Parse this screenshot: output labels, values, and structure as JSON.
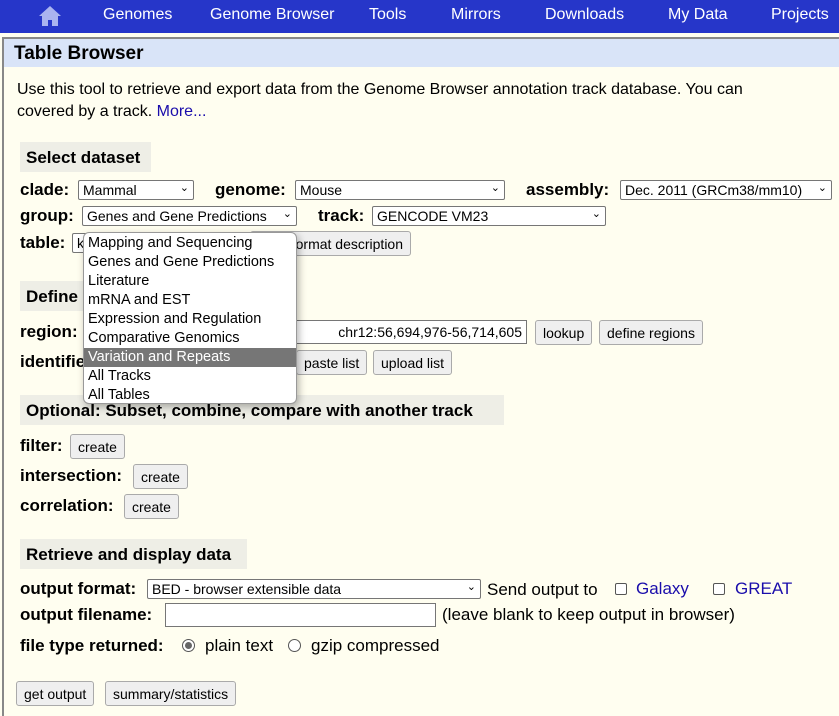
{
  "nav": {
    "home_icon": "home-icon",
    "items": [
      "Genomes",
      "Genome Browser",
      "Tools",
      "Mirrors",
      "Downloads",
      "My Data",
      "Projects"
    ]
  },
  "title": "Table Browser",
  "intro": {
    "line1": "Use this tool to retrieve and export data from the Genome Browser annotation track database. You can",
    "line2": "covered by a track.",
    "more": "More..."
  },
  "dataset": {
    "header": "Select dataset",
    "clade_label": "clade:",
    "clade": "Mammal",
    "genome_label": "genome:",
    "genome": "Mouse",
    "assembly_label": "assembly:",
    "assembly": "Dec. 2011 (GRCm38/mm10)",
    "group_label": "group:",
    "group": "Genes and Gene Predictions",
    "track_label": "track:",
    "track": "GENCODE VM23",
    "table_label": "table:",
    "table": "knownGene",
    "describe_button": "data format description"
  },
  "group_options": [
    "Mapping and Sequencing",
    "Genes and Gene Predictions",
    "Literature",
    "mRNA and EST",
    "Expression and Regulation",
    "Comparative Genomics",
    "Variation and Repeats",
    "All Tracks",
    "All Tables"
  ],
  "group_highlighted": "Variation and Repeats",
  "region": {
    "header": "Define region of interest",
    "label": "region:",
    "value": "chr12:56,694,976-56,714,605",
    "lookup": "lookup",
    "define": "define regions",
    "identifiers_label": "identifiers (names/accessions):",
    "paste": "paste list",
    "upload": "upload list"
  },
  "optional": {
    "header": "Optional: Subset, combine, compare with another track",
    "filter_label": "filter:",
    "intersection_label": "intersection:",
    "correlation_label": "correlation:",
    "create": "create"
  },
  "retrieve": {
    "header": "Retrieve and display data",
    "format_label": "output format:",
    "format": "BED - browser extensible data",
    "send_to": "Send output to",
    "galaxy": "Galaxy",
    "great": "GREAT",
    "filename_label": "output filename:",
    "filename_value": "",
    "filename_hint": "(leave blank to keep output in browser)",
    "filetype_label": "file type returned:",
    "plain": "plain text",
    "gzip": "gzip compressed",
    "get_output": "get output",
    "summary": "summary/statistics"
  }
}
